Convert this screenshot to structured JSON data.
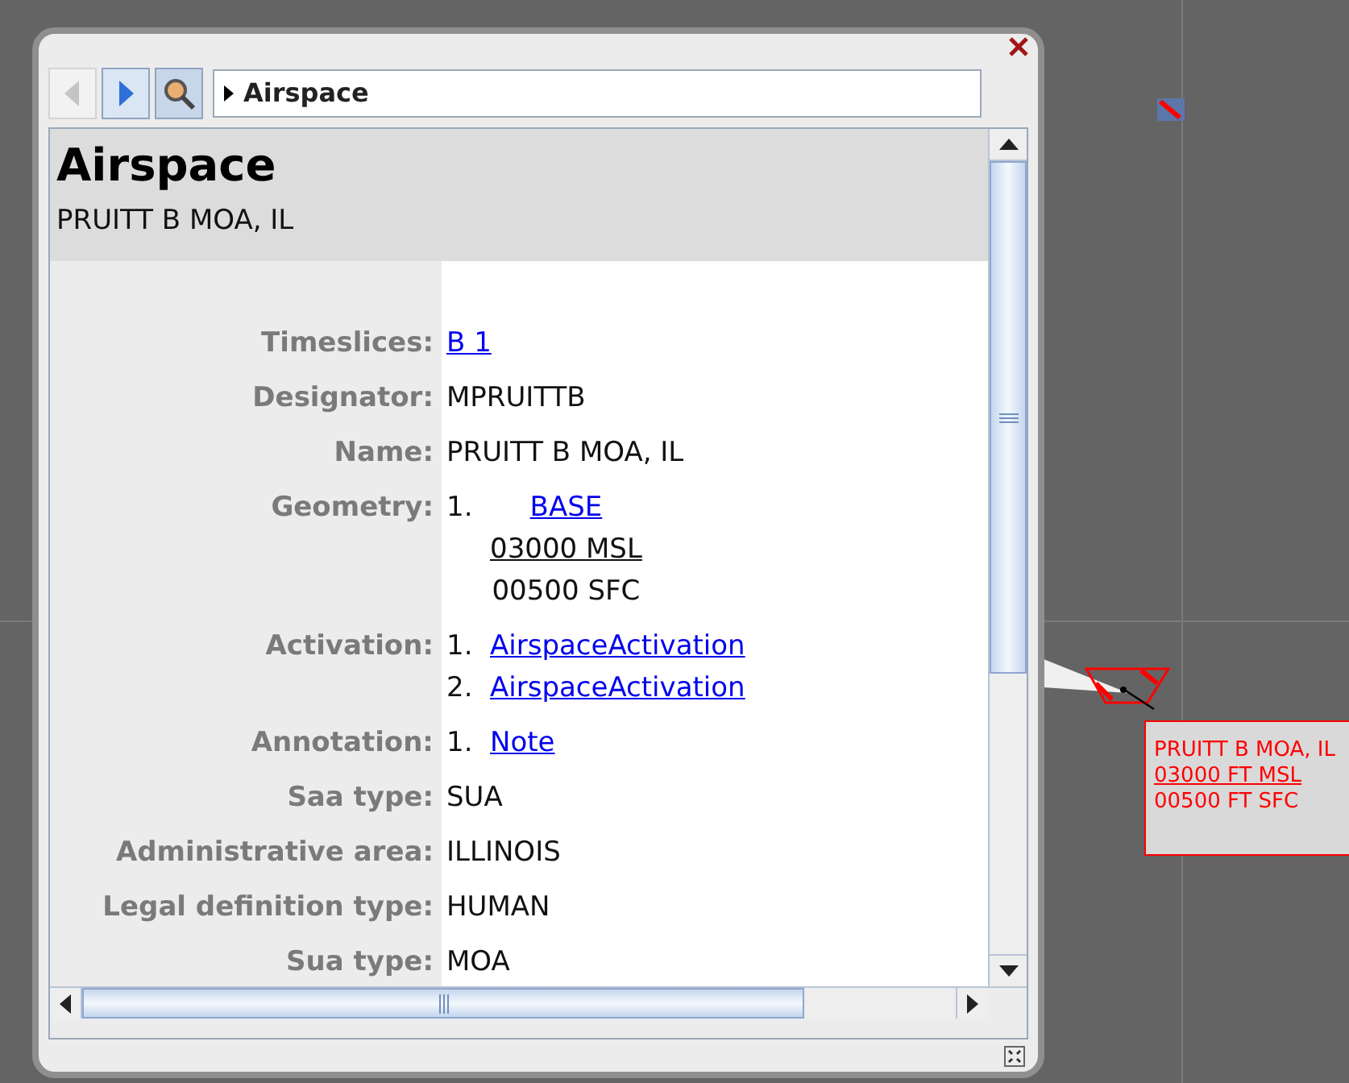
{
  "toolbar": {
    "back": {
      "disabled": true
    },
    "forward": {
      "disabled": false
    },
    "breadcrumb": "Airspace"
  },
  "header": {
    "title": "Airspace",
    "subtitle": "PRUITT B MOA, IL"
  },
  "properties": [
    {
      "label": "Timeslices:",
      "items": [
        {
          "lines": [
            {
              "kind": "link",
              "text": "B 1"
            }
          ]
        }
      ]
    },
    {
      "label": "Designator:",
      "items": [
        {
          "lines": [
            {
              "kind": "text",
              "text": "MPRUITTB"
            }
          ]
        }
      ]
    },
    {
      "label": "Name:",
      "items": [
        {
          "lines": [
            {
              "kind": "text",
              "text": "PRUITT B MOA, IL"
            }
          ]
        }
      ]
    },
    {
      "label": "Geometry:",
      "items": [
        {
          "number": "1.",
          "lines": [
            {
              "kind": "link",
              "text": "BASE"
            },
            {
              "kind": "underlined",
              "text": "03000 MSL"
            },
            {
              "kind": "text",
              "text": "00500 SFC"
            }
          ]
        }
      ]
    },
    {
      "label": "Activation:",
      "items": [
        {
          "number": "1.",
          "lines": [
            {
              "kind": "link",
              "text": "AirspaceActivation"
            }
          ]
        },
        {
          "number": "2.",
          "lines": [
            {
              "kind": "link",
              "text": "AirspaceActivation"
            }
          ]
        }
      ]
    },
    {
      "label": "Annotation:",
      "items": [
        {
          "number": "1.",
          "lines": [
            {
              "kind": "link",
              "text": "Note"
            }
          ]
        }
      ]
    },
    {
      "label": "Saa type:",
      "items": [
        {
          "lines": [
            {
              "kind": "text",
              "text": "SUA"
            }
          ]
        }
      ]
    },
    {
      "label": "Administrative area:",
      "items": [
        {
          "lines": [
            {
              "kind": "text",
              "text": "ILLINOIS"
            }
          ]
        }
      ]
    },
    {
      "label": "Legal definition type:",
      "items": [
        {
          "lines": [
            {
              "kind": "text",
              "text": "HUMAN"
            }
          ]
        }
      ]
    },
    {
      "label": "Sua type:",
      "items": [
        {
          "lines": [
            {
              "kind": "text",
              "text": "MOA"
            }
          ]
        }
      ]
    }
  ],
  "map_label": {
    "lines": [
      {
        "kind": "text",
        "text": "PRUITT B MOA, IL"
      },
      {
        "kind": "underlined",
        "text": "03000 FT MSL"
      },
      {
        "kind": "text",
        "text": "00500 FT SFC"
      }
    ]
  }
}
